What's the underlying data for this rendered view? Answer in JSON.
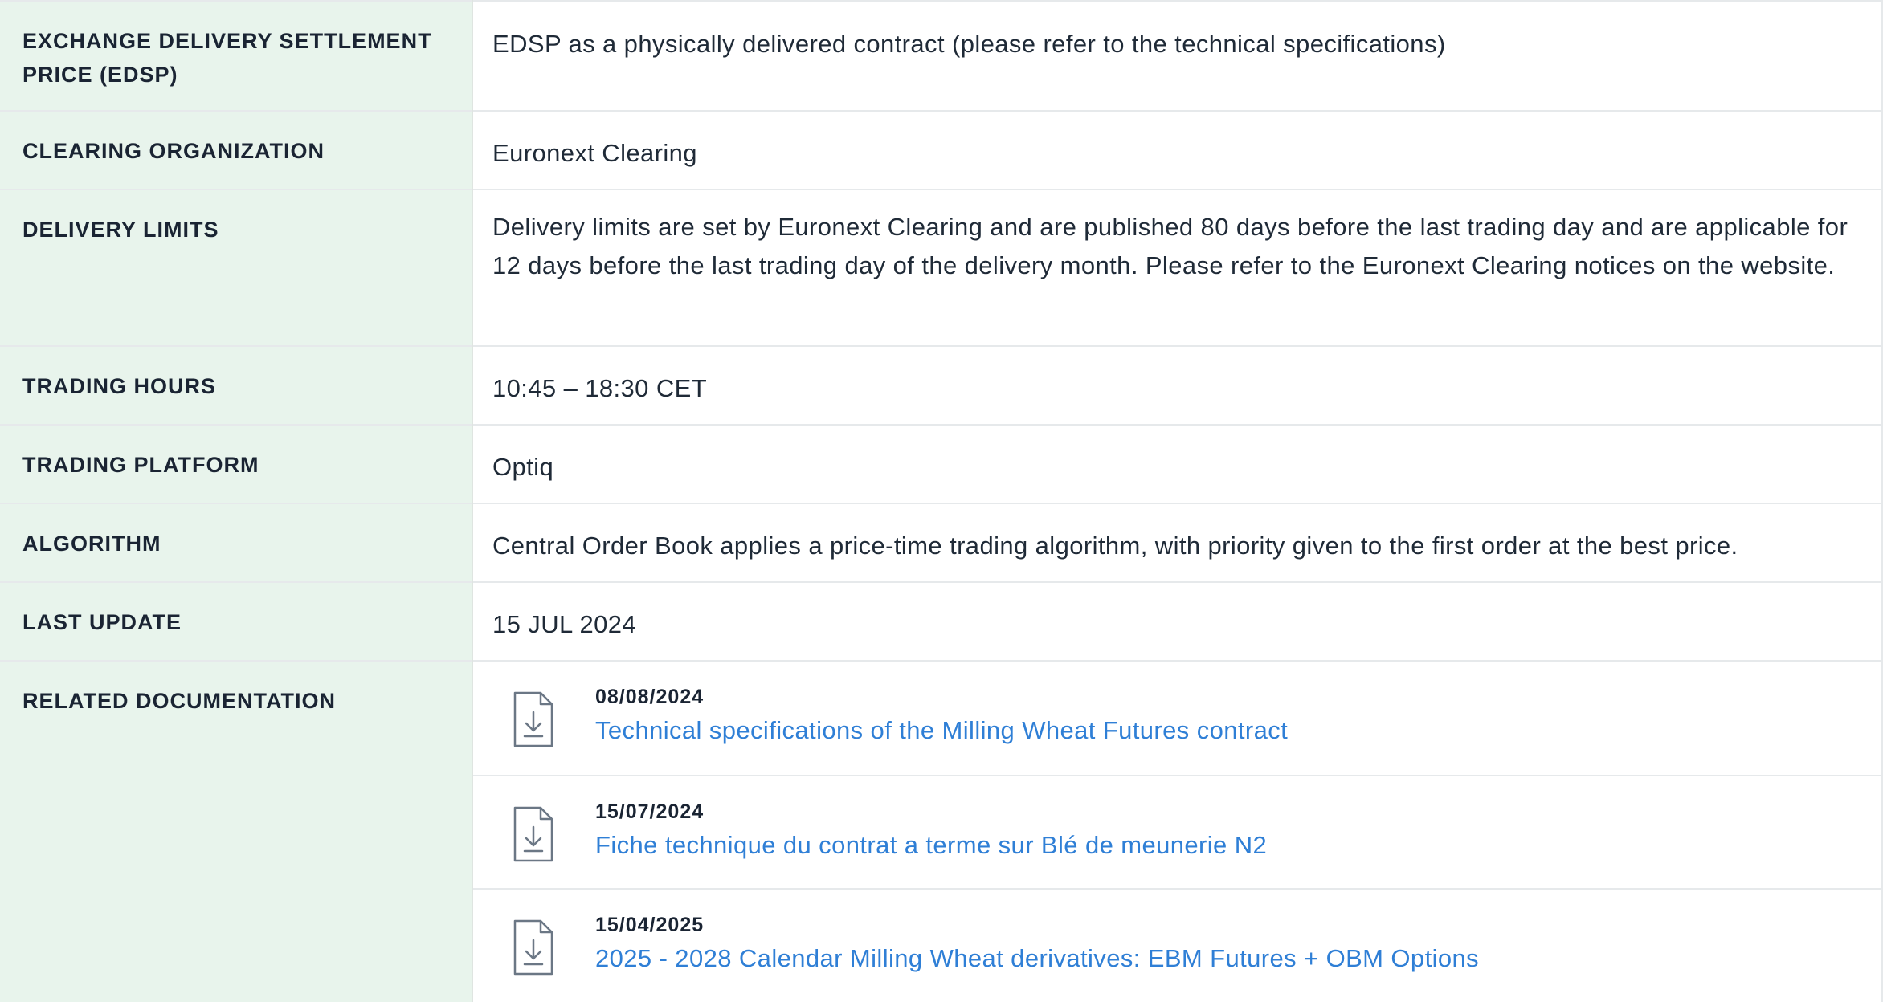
{
  "rows": [
    {
      "label": "EXCHANGE DELIVERY SETTLEMENT PRICE (EDSP)",
      "value": "EDSP as a physically delivered contract (please refer to the technical specifications)"
    },
    {
      "label": "CLEARING ORGANIZATION",
      "value": "Euronext Clearing"
    },
    {
      "label": "DELIVERY LIMITS",
      "value": "Delivery limits are set by Euronext Clearing and are published 80 days before the last trading day and are applicable for 12 days before the last trading day of the delivery month. Please refer to the Euronext Clearing notices on the website."
    },
    {
      "label": "TRADING HOURS",
      "value": "10:45 – 18:30 CET"
    },
    {
      "label": "TRADING PLATFORM",
      "value": "Optiq"
    },
    {
      "label": "ALGORITHM",
      "value": "Central Order Book applies a price-time trading algorithm, with priority given to the first order at the best price."
    },
    {
      "label": "LAST UPDATE",
      "value": "15 JUL 2024"
    }
  ],
  "related_documentation": {
    "label": "RELATED DOCUMENTATION",
    "icon": "file-download-icon",
    "documents": [
      {
        "date": "08/08/2024",
        "title": "Technical specifications of the Milling Wheat Futures contract"
      },
      {
        "date": "15/07/2024",
        "title": "Fiche technique du contrat a terme sur Blé de meunerie N2"
      },
      {
        "date": "15/04/2025",
        "title": "2025 - 2028 Calendar Milling Wheat derivatives: EBM Futures + OBM Options"
      }
    ]
  },
  "colors": {
    "label_background": "#e8f4ec",
    "link": "#2f7fd6",
    "text": "#1f2a37",
    "border": "#e6e9eb"
  }
}
